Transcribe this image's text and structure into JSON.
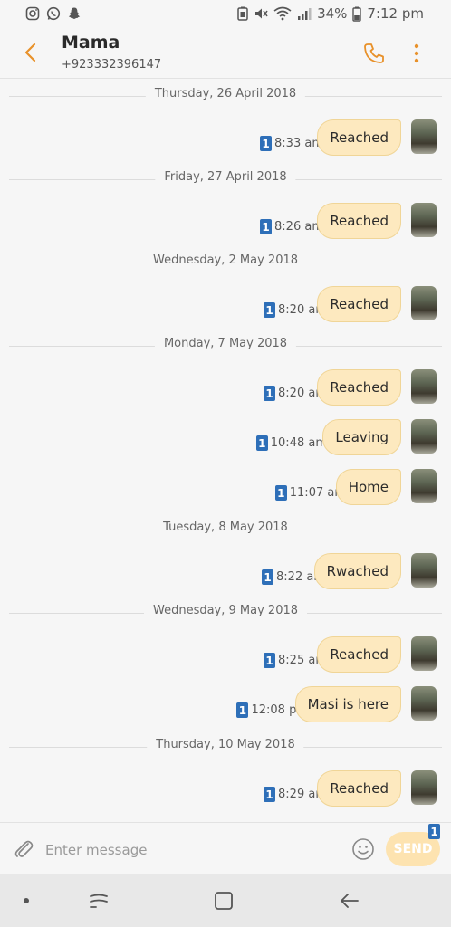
{
  "status_bar": {
    "battery_percent": "34%",
    "time": "7:12 pm"
  },
  "header": {
    "contact_name": "Mama",
    "contact_number": "+923332396147"
  },
  "conversation": {
    "date_1": "Thursday, 26 April 2018",
    "date_2": "Friday, 27 April 2018",
    "date_3": "Wednesday, 2 May 2018",
    "date_4": "Monday, 7 May 2018",
    "date_5": "Tuesday, 8 May 2018",
    "date_6": "Wednesday, 9 May 2018",
    "date_7": "Thursday, 10 May 2018",
    "messages": [
      {
        "text": "Reached",
        "time": "8:33 am",
        "sim": "1"
      },
      {
        "text": "Reached",
        "time": "8:26 am",
        "sim": "1"
      },
      {
        "text": "Reached",
        "time": "8:20 am",
        "sim": "1"
      },
      {
        "text": "Reached",
        "time": "8:20 am",
        "sim": "1"
      },
      {
        "text": "Leaving",
        "time": "10:48 am",
        "sim": "1"
      },
      {
        "text": "Home",
        "time": "11:07 am",
        "sim": "1"
      },
      {
        "text": "Rwached",
        "time": "8:22 am",
        "sim": "1"
      },
      {
        "text": "Reached",
        "time": "8:25 am",
        "sim": "1"
      },
      {
        "text": "Masi is here",
        "time": "12:08 pm",
        "sim": "1"
      },
      {
        "text": "Reached",
        "time": "8:29 am",
        "sim": "1"
      }
    ]
  },
  "composer": {
    "placeholder": "Enter message",
    "send_label": "SEND",
    "send_sim": "1"
  },
  "colors": {
    "accent": "#e8912a",
    "bubble": "#fde9bf",
    "sim_badge": "#2e6fb8"
  }
}
